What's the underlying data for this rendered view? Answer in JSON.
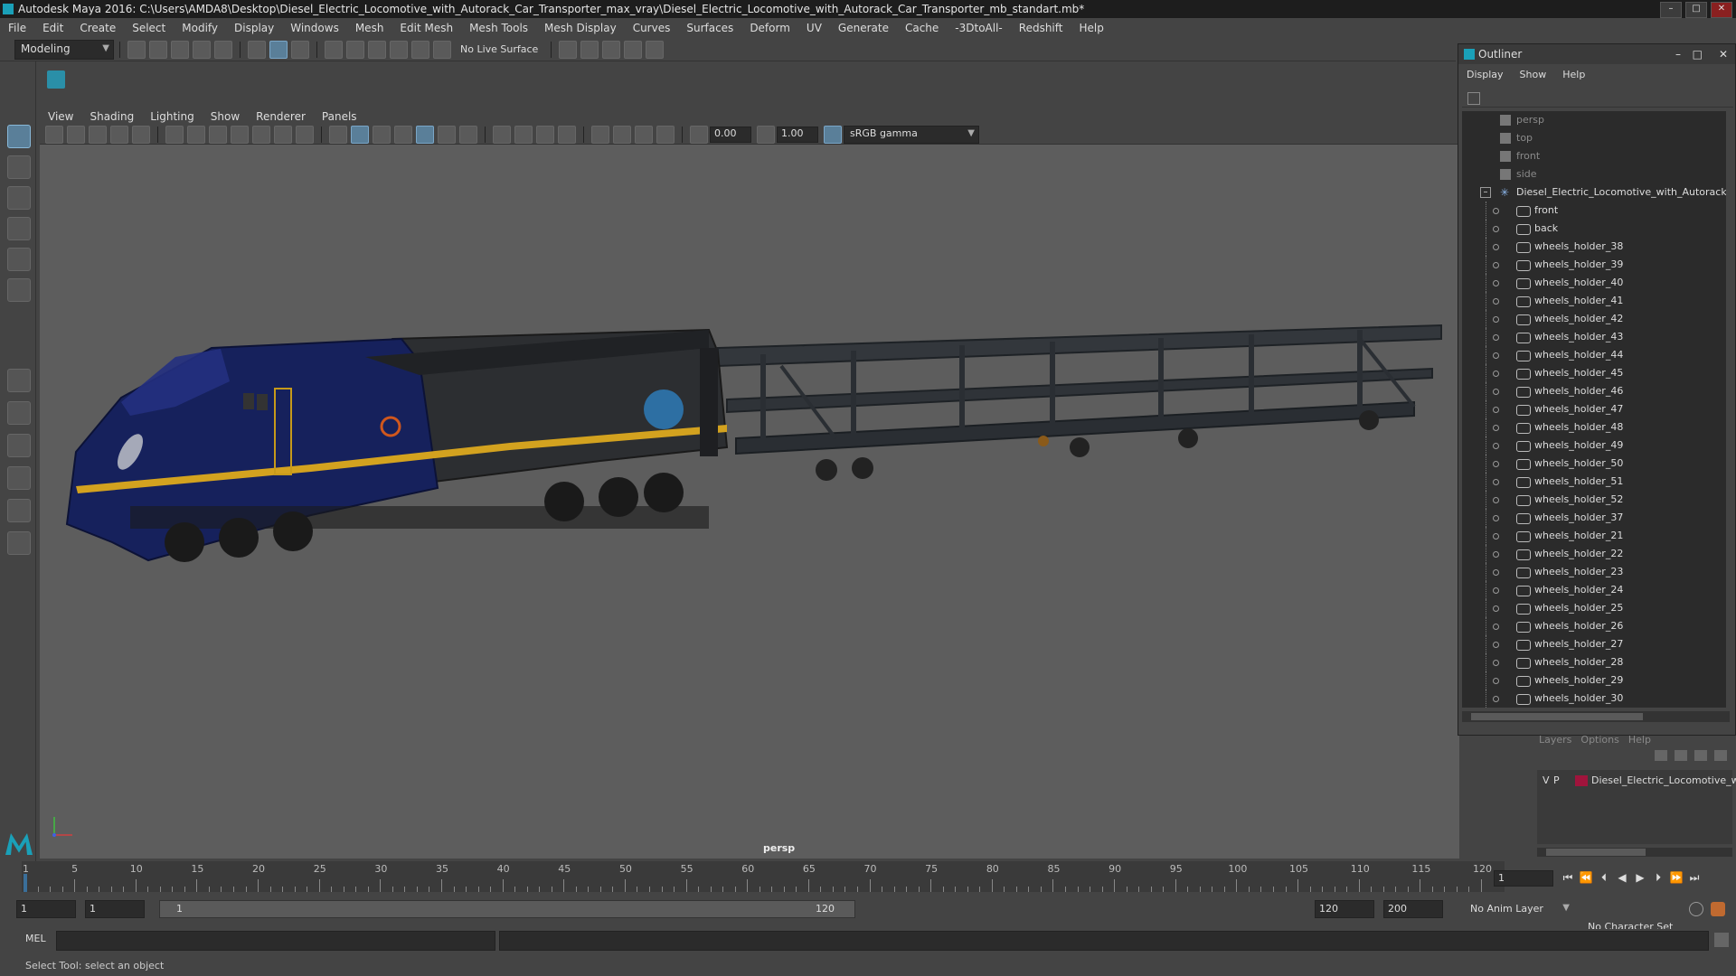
{
  "window": {
    "title": "Autodesk Maya 2016: C:\\Users\\AMDA8\\Desktop\\Diesel_Electric_Locomotive_with_Autorack_Car_Transporter_max_vray\\Diesel_Electric_Locomotive_with_Autorack_Car_Transporter_mb_standart.mb*"
  },
  "menubar": [
    "File",
    "Edit",
    "Create",
    "Select",
    "Modify",
    "Display",
    "Windows",
    "Mesh",
    "Edit Mesh",
    "Mesh Tools",
    "Mesh Display",
    "Curves",
    "Surfaces",
    "Deform",
    "UV",
    "Generate",
    "Cache",
    "-3DtoAll-",
    "Redshift",
    "Help"
  ],
  "shelf": {
    "mode": "Modeling",
    "live_surface": "No Live Surface"
  },
  "panel": {
    "menus": [
      "View",
      "Shading",
      "Lighting",
      "Show",
      "Renderer",
      "Panels"
    ],
    "exposure": "0.00",
    "gamma": "1.00",
    "colorspace": "sRGB gamma",
    "camera_label": "persp"
  },
  "outliner": {
    "title": "Outliner",
    "menus": [
      "Display",
      "Show",
      "Help"
    ],
    "cameras": [
      "persp",
      "top",
      "front",
      "side"
    ],
    "group": "Diesel_Electric_Locomotive_with_Autorack_C",
    "children": [
      "front",
      "back",
      "wheels_holder_38",
      "wheels_holder_39",
      "wheels_holder_40",
      "wheels_holder_41",
      "wheels_holder_42",
      "wheels_holder_43",
      "wheels_holder_44",
      "wheels_holder_45",
      "wheels_holder_46",
      "wheels_holder_47",
      "wheels_holder_48",
      "wheels_holder_49",
      "wheels_holder_50",
      "wheels_holder_51",
      "wheels_holder_52",
      "wheels_holder_37",
      "wheels_holder_21",
      "wheels_holder_22",
      "wheels_holder_23",
      "wheels_holder_24",
      "wheels_holder_25",
      "wheels_holder_26",
      "wheels_holder_27",
      "wheels_holder_28",
      "wheels_holder_29",
      "wheels_holder_30"
    ]
  },
  "layers": {
    "menus": [
      "Layers",
      "Options",
      "Help"
    ],
    "row": {
      "v": "V",
      "p": "P",
      "name": "Diesel_Electric_Locomotive_wit",
      "color": "#a0143c"
    }
  },
  "timeline": {
    "ticks": [
      "1",
      "5",
      "10",
      "15",
      "20",
      "25",
      "30",
      "35",
      "40",
      "45",
      "50",
      "55",
      "60",
      "65",
      "70",
      "75",
      "80",
      "85",
      "90",
      "95",
      "100",
      "105",
      "110",
      "115",
      "120"
    ],
    "current_frame": "1"
  },
  "range": {
    "start": "1",
    "start2": "1",
    "slider_start": "1",
    "slider_end": "120",
    "end": "120",
    "end2": "200",
    "anim_layer": "No Anim Layer",
    "char_set": "No Character Set"
  },
  "command": {
    "label": "MEL"
  },
  "help_line": "Select Tool: select an object",
  "colors": {
    "accent": "#5a7f99",
    "viewport_bg": "#5d5d5d",
    "loco_blue": "#16215c",
    "loco_yellow": "#d3a21f"
  }
}
